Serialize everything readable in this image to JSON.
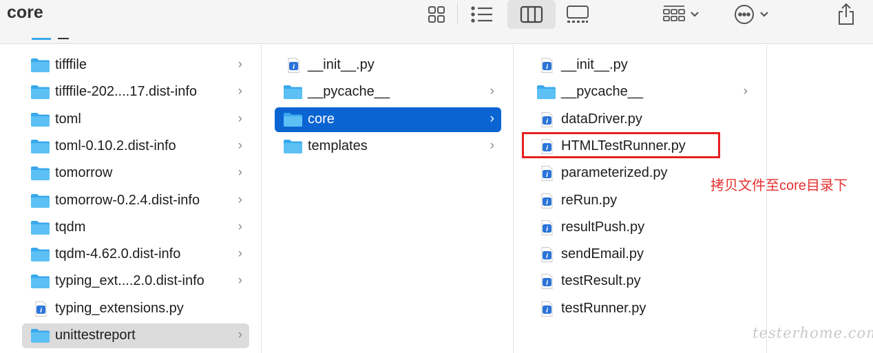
{
  "window": {
    "title": "core"
  },
  "toolbar": {
    "buttons": [
      {
        "name": "icon-view-button",
        "icon": "grid-icon"
      },
      {
        "name": "list-view-button",
        "icon": "list-icon"
      },
      {
        "name": "column-view-button",
        "icon": "columns-icon",
        "selected": true
      },
      {
        "name": "gallery-view-button",
        "icon": "gallery-icon"
      },
      {
        "name": "group-button",
        "icon": "group-icon"
      },
      {
        "name": "more-actions-button",
        "icon": "ellipsis-circle-icon"
      },
      {
        "name": "share-button",
        "icon": "share-icon"
      }
    ]
  },
  "columns": [
    {
      "items": [
        {
          "name": "tifffile",
          "type": "folder",
          "arrow": true
        },
        {
          "name": "tifffile-202....17.dist-info",
          "type": "folder",
          "arrow": true
        },
        {
          "name": "toml",
          "type": "folder",
          "arrow": true
        },
        {
          "name": "toml-0.10.2.dist-info",
          "type": "folder",
          "arrow": true
        },
        {
          "name": "tomorrow",
          "type": "folder",
          "arrow": true
        },
        {
          "name": "tomorrow-0.2.4.dist-info",
          "type": "folder",
          "arrow": true
        },
        {
          "name": "tqdm",
          "type": "folder",
          "arrow": true
        },
        {
          "name": "tqdm-4.62.0.dist-info",
          "type": "folder",
          "arrow": true
        },
        {
          "name": "typing_ext....2.0.dist-info",
          "type": "folder",
          "arrow": true
        },
        {
          "name": "typing_extensions.py",
          "type": "file",
          "arrow": false
        },
        {
          "name": "unittestreport",
          "type": "folder",
          "arrow": true,
          "state": "selected-inactive"
        }
      ]
    },
    {
      "items": [
        {
          "name": "__init__.py",
          "type": "file",
          "arrow": false
        },
        {
          "name": "__pycache__",
          "type": "folder",
          "arrow": true
        },
        {
          "name": "core",
          "type": "folder",
          "arrow": true,
          "state": "selected"
        },
        {
          "name": "templates",
          "type": "folder",
          "arrow": true
        }
      ]
    },
    {
      "items": [
        {
          "name": "__init__.py",
          "type": "file",
          "arrow": false
        },
        {
          "name": "__pycache__",
          "type": "folder",
          "arrow": true
        },
        {
          "name": "dataDriver.py",
          "type": "file",
          "arrow": false
        },
        {
          "name": "HTMLTestRunner.py",
          "type": "file",
          "arrow": false,
          "highlighted": true
        },
        {
          "name": "parameterized.py",
          "type": "file",
          "arrow": false
        },
        {
          "name": "reRun.py",
          "type": "file",
          "arrow": false
        },
        {
          "name": "resultPush.py",
          "type": "file",
          "arrow": false
        },
        {
          "name": "sendEmail.py",
          "type": "file",
          "arrow": false
        },
        {
          "name": "testResult.py",
          "type": "file",
          "arrow": false
        },
        {
          "name": "testRunner.py",
          "type": "file",
          "arrow": false
        }
      ]
    }
  ],
  "annotation": {
    "text": "拷贝文件至core目录下",
    "color": "#e63030"
  },
  "watermark": {
    "text": "testerhome.com"
  },
  "colors": {
    "selection": "#0a64d2",
    "folder": "#3aa8ec",
    "highlight": "#e62020"
  }
}
